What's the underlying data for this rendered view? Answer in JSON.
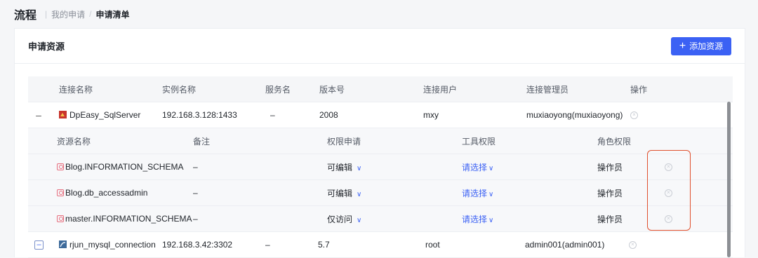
{
  "breadcrumb": {
    "title": "流程",
    "level1": "我的申请",
    "separator": "/",
    "current": "申请清单"
  },
  "card": {
    "title": "申请资源",
    "add_button_label": "添加资源",
    "add_button_icon": "+"
  },
  "table": {
    "headers": [
      "连接名称",
      "实例名称",
      "服务名",
      "版本号",
      "连接用户",
      "连接管理员",
      "操作"
    ],
    "connections": [
      {
        "expander": "–",
        "name": "DpEasy_SqlServer",
        "instance": "192.168.3.128:1433",
        "service": "–",
        "version": "2008",
        "user": "mxy",
        "admin": "muxiaoyong(muxiaoyong)"
      },
      {
        "expander": "–",
        "name": "rjun_mysql_connection",
        "instance": "192.168.3.42:3302",
        "service": "–",
        "version": "5.7",
        "user": "root",
        "admin": "admin001(admin001)"
      }
    ],
    "sub_headers": [
      "资源名称",
      "备注",
      "权限申请",
      "工具权限",
      "角色权限"
    ],
    "resources": [
      {
        "name": "Blog.INFORMATION_SCHEMA",
        "note": "–",
        "permission": "可编辑",
        "tool": "请选择",
        "role": "操作员"
      },
      {
        "name": "Blog.db_accessadmin",
        "note": "–",
        "permission": "可编辑",
        "tool": "请选择",
        "role": "操作员"
      },
      {
        "name": "master.INFORMATION_SCHEMA",
        "note": "–",
        "permission": "仅访问",
        "tool": "请选择",
        "role": "操作员"
      }
    ]
  },
  "colors": {
    "accent": "#3b61f4",
    "highlight": "#e0502d"
  }
}
